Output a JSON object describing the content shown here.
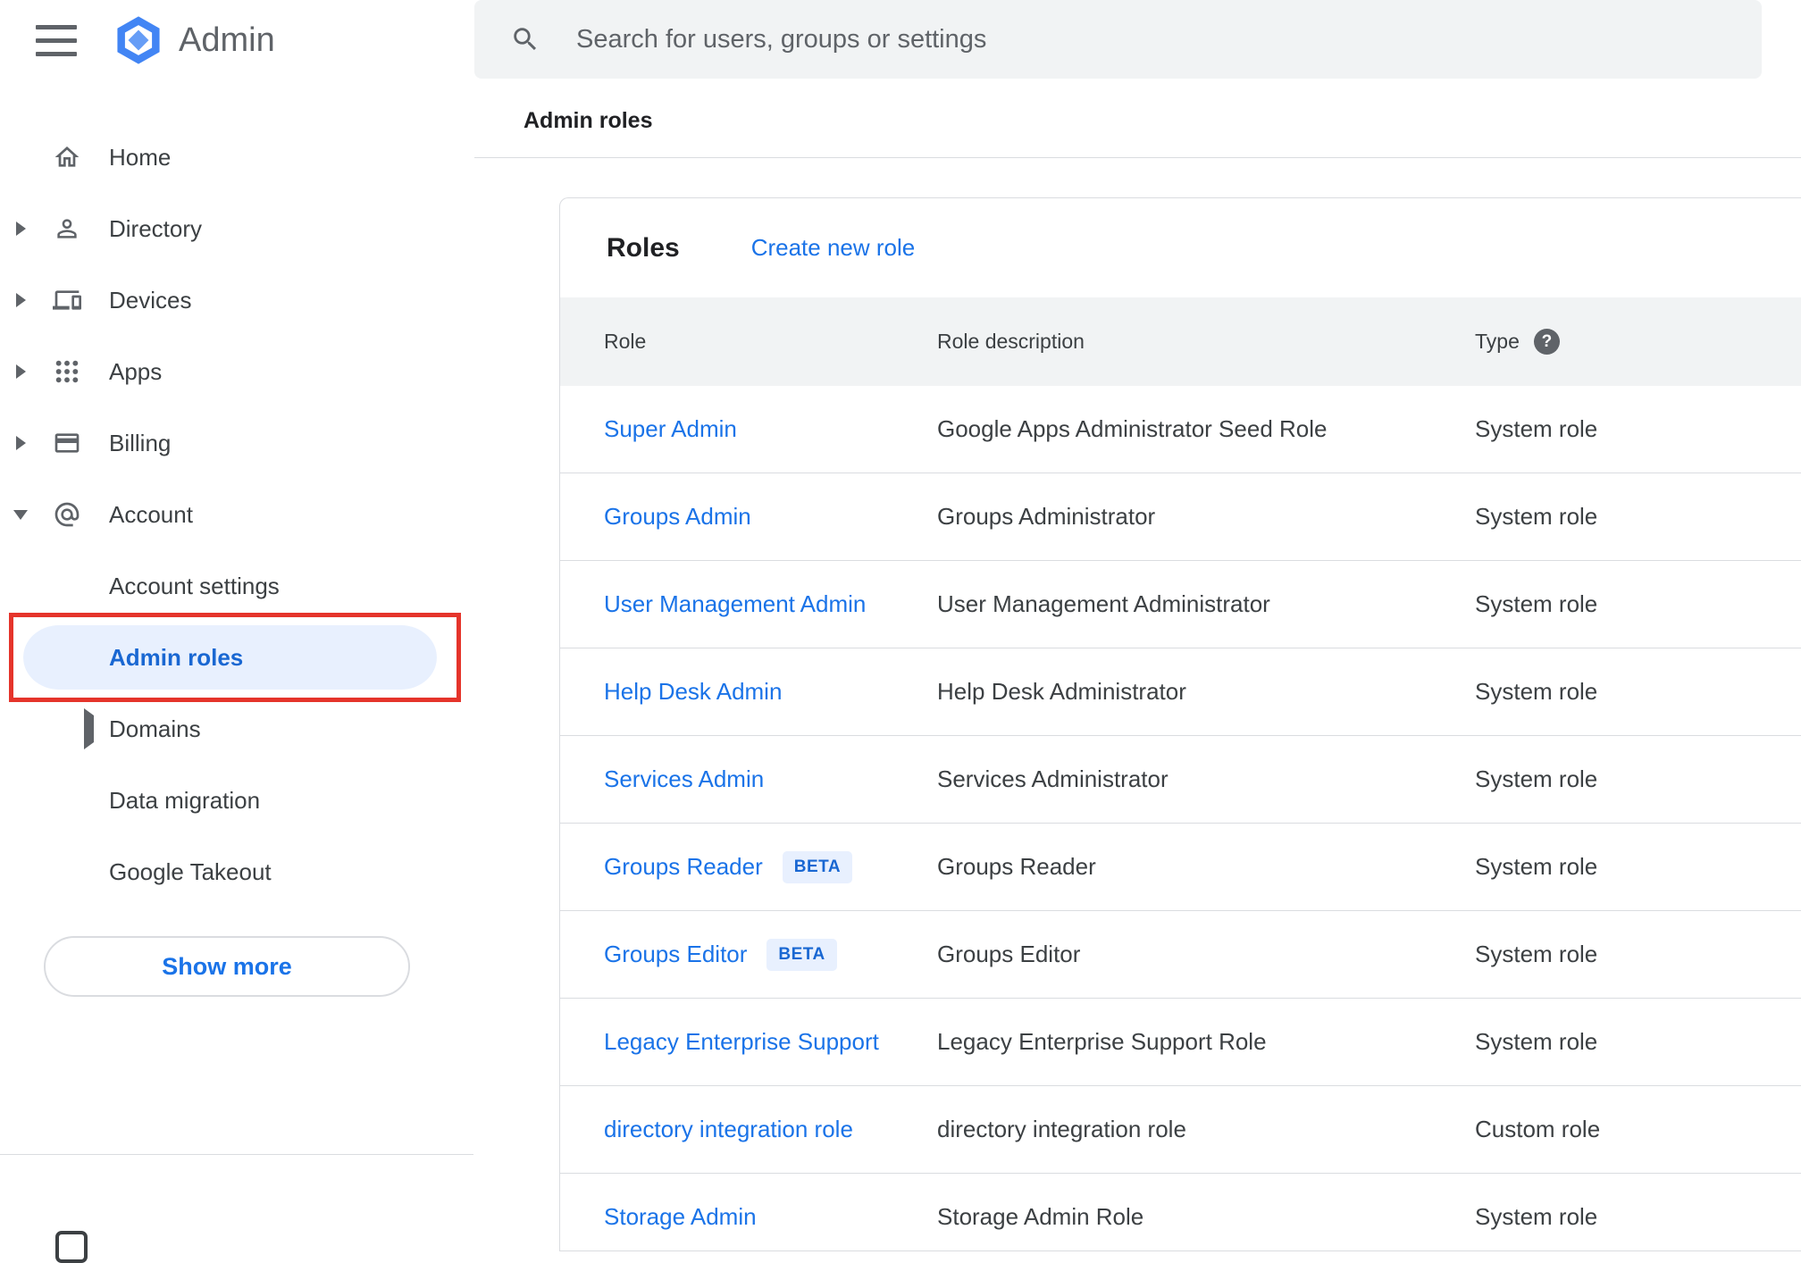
{
  "app": {
    "product_name": "Admin"
  },
  "search": {
    "placeholder": "Search for users, groups or settings"
  },
  "breadcrumb": "Admin roles",
  "sidebar": {
    "items": [
      {
        "label": "Home",
        "icon": "home-icon",
        "expandable": false
      },
      {
        "label": "Directory",
        "icon": "person-icon",
        "expandable": true
      },
      {
        "label": "Devices",
        "icon": "devices-icon",
        "expandable": true
      },
      {
        "label": "Apps",
        "icon": "apps-grid-icon",
        "expandable": true
      },
      {
        "label": "Billing",
        "icon": "credit-card-icon",
        "expandable": true
      },
      {
        "label": "Account",
        "icon": "at-sign-icon",
        "expandable": true,
        "expanded": true
      }
    ],
    "sub_items": [
      {
        "label": "Account settings",
        "selected": false
      },
      {
        "label": "Admin roles",
        "selected": true
      },
      {
        "label": "Domains",
        "expandable": true,
        "selected": false
      },
      {
        "label": "Data migration",
        "selected": false
      },
      {
        "label": "Google Takeout",
        "selected": false
      }
    ],
    "show_more_label": "Show more"
  },
  "main": {
    "title": "Roles",
    "create_role_link": "Create new role",
    "table": {
      "columns": [
        "Role",
        "Role description",
        "Type"
      ],
      "rows": [
        {
          "role": "Super Admin",
          "badge": "",
          "description": "Google Apps Administrator Seed Role",
          "type": "System role"
        },
        {
          "role": "Groups Admin",
          "badge": "",
          "description": "Groups Administrator",
          "type": "System role"
        },
        {
          "role": "User Management Admin",
          "badge": "",
          "description": "User Management Administrator",
          "type": "System role"
        },
        {
          "role": "Help Desk Admin",
          "badge": "",
          "description": "Help Desk Administrator",
          "type": "System role"
        },
        {
          "role": "Services Admin",
          "badge": "",
          "description": "Services Administrator",
          "type": "System role"
        },
        {
          "role": "Groups Reader",
          "badge": "BETA",
          "description": "Groups Reader",
          "type": "System role"
        },
        {
          "role": "Groups Editor",
          "badge": "BETA",
          "description": "Groups Editor",
          "type": "System role"
        },
        {
          "role": "Legacy Enterprise Support",
          "badge": "",
          "description": "Legacy Enterprise Support Role",
          "type": "System role"
        },
        {
          "role": "directory integration role",
          "badge": "",
          "description": "directory integration role",
          "type": "Custom role"
        },
        {
          "role": "Storage Admin",
          "badge": "",
          "description": "Storage Admin Role",
          "type": "System role"
        }
      ]
    },
    "help_glyph": "?"
  },
  "colors": {
    "link_blue": "#1a73e8",
    "selected_blue": "#1967d2",
    "selected_bg": "#e8f0fe",
    "annotation_red": "#e5342b",
    "surface_gray": "#f1f3f4",
    "divider": "#dadce0",
    "text_primary": "#202124",
    "text_secondary": "#3c4043",
    "icon_gray": "#5f6368"
  }
}
